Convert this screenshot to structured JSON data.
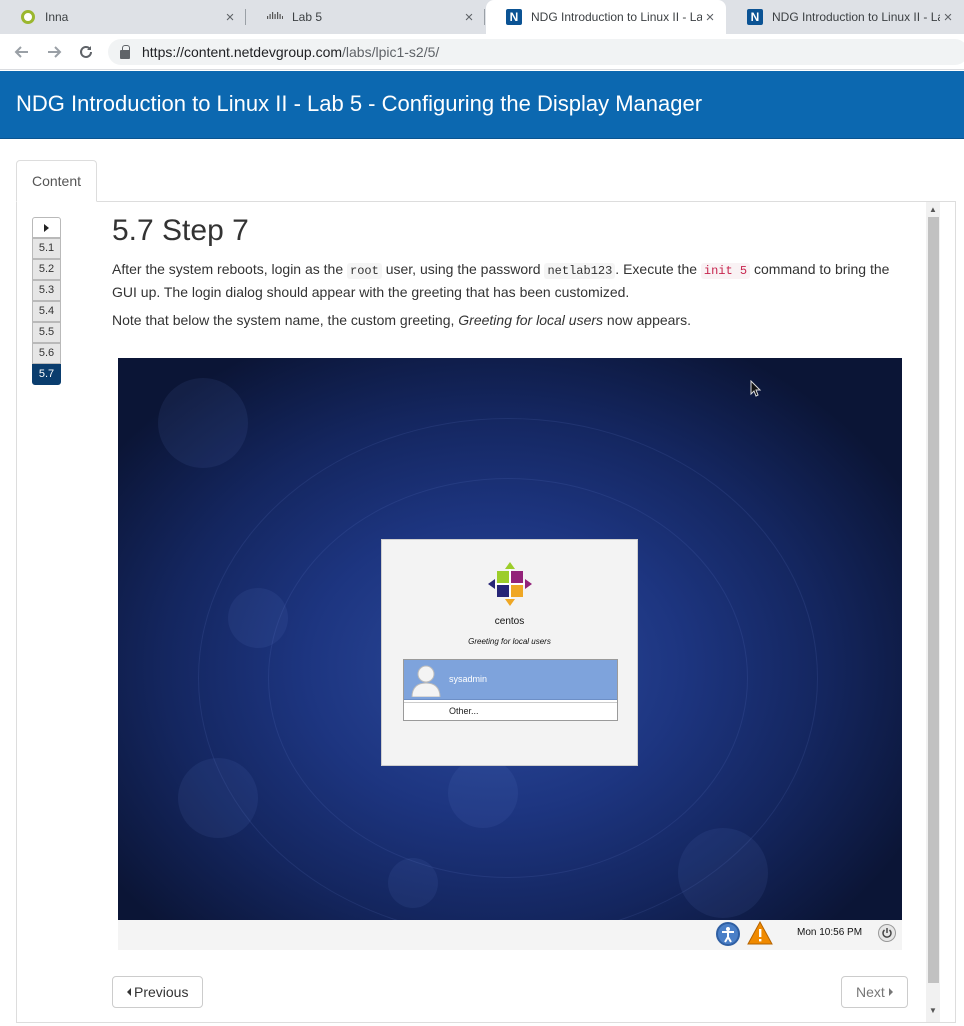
{
  "browser": {
    "tabs": [
      {
        "title": "Inna",
        "icon": "inna-favicon-icon"
      },
      {
        "title": "Lab 5",
        "icon": "cisco-favicon-icon"
      },
      {
        "title": "NDG Introduction to Linux II - La",
        "icon": "ndg-favicon-icon",
        "active": true
      },
      {
        "title": "NDG Introduction to Linux II - La",
        "icon": "ndg-favicon-icon"
      }
    ],
    "close_glyph": "×",
    "url_host": "https://content.netdevgroup.com",
    "url_path": "/labs/lpic1-s2/5/"
  },
  "page": {
    "banner_title": "NDG Introduction to Linux II - Lab 5 - Configuring the Display Manager",
    "content_tab": "Content",
    "steps": [
      "5.1",
      "5.2",
      "5.3",
      "5.4",
      "5.5",
      "5.6",
      "5.7"
    ],
    "active_step": "5.7",
    "step_title": "5.7 Step 7",
    "para1": {
      "t1": "After the system reboots, login as the ",
      "code1": "root",
      "t2": " user, using the password ",
      "code2": "netlab123",
      "t3": ". Execute the ",
      "code3": "init 5",
      "t4": " command to bring the GUI up. The login dialog should appear with the greeting that has been customized."
    },
    "para2": {
      "t1": "Note that below the system name, the custom greeting, ",
      "em": "Greeting for local users",
      "t2": " now appears."
    },
    "screenshot": {
      "hostname": "centos",
      "greeting": "Greeting for local users",
      "user": "sysadmin",
      "other": "Other...",
      "clock": "Mon 10:56 PM"
    },
    "prev_label": "Previous",
    "next_label": "Next"
  },
  "colors": {
    "banner": "#0c68b0",
    "active_step": "#0a3d6e",
    "code_pink": "#c7254e"
  }
}
